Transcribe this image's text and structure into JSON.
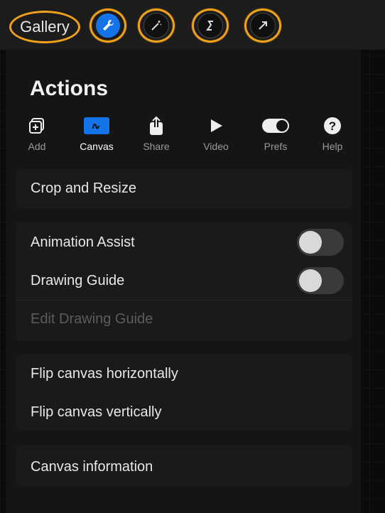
{
  "topbar": {
    "gallery_label": "Gallery",
    "annotations": [
      "1",
      "1",
      "2",
      "3",
      "4"
    ]
  },
  "panel": {
    "title": "Actions",
    "tabs": [
      {
        "label": "Add",
        "icon": "add-icon"
      },
      {
        "label": "Canvas",
        "icon": "canvas-icon"
      },
      {
        "label": "Share",
        "icon": "share-icon"
      },
      {
        "label": "Video",
        "icon": "video-play-icon"
      },
      {
        "label": "Prefs",
        "icon": "prefs-toggle-icon"
      },
      {
        "label": "Help",
        "icon": "help-icon"
      }
    ],
    "active_tab": "Canvas",
    "items": {
      "crop": "Crop and Resize",
      "animation_assist": "Animation Assist",
      "drawing_guide": "Drawing Guide",
      "edit_drawing_guide": "Edit Drawing Guide",
      "flip_h": "Flip canvas horizontally",
      "flip_v": "Flip canvas vertically",
      "info": "Canvas information"
    },
    "toggles": {
      "animation_assist": false,
      "drawing_guide": false
    }
  },
  "colors": {
    "accent": "#1575e8",
    "annotation": "#f0a21a"
  }
}
